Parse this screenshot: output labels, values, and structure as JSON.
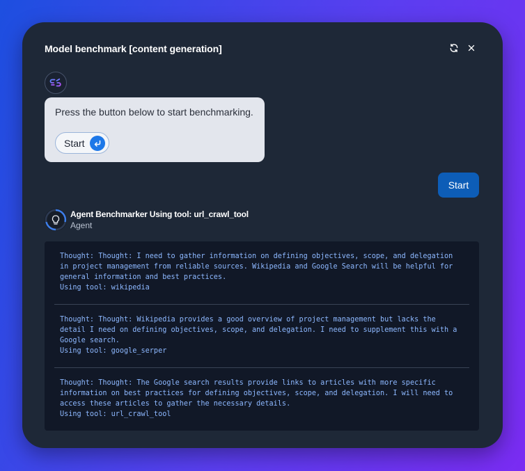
{
  "dialog": {
    "title": "Model benchmark [content generation]"
  },
  "header_icons": [
    "refresh-icon",
    "close-icon"
  ],
  "bot_message": {
    "text": "Press the button below to start benchmarking.",
    "start_button_label": "Start"
  },
  "user_message": {
    "text": "Start"
  },
  "agent": {
    "name": "Agent Benchmarker Using tool: url_crawl_tool",
    "role": "Agent"
  },
  "log_entries": [
    "Thought: Thought: I need to gather information on defining objectives, scope, and delegation\nin project management from reliable sources. Wikipedia and Google Search will be helpful for\ngeneral information and best practices.\nUsing tool: wikipedia",
    "Thought: Thought: Wikipedia provides a good overview of project management but lacks the\ndetail I need on defining objectives, scope, and delegation. I need to supplement this with a\nGoogle search.\nUsing tool: google_serper",
    "Thought: Thought: The Google search results provide links to articles with more specific\ninformation on best practices for defining objectives, scope, and delegation. I will need to\naccess these articles to gather the necessary details.\nUsing tool: url_crawl_tool"
  ],
  "colors": {
    "panel_bg": "#1e2837",
    "bubble_bg": "#e3e6ed",
    "accent_blue": "#0d5db7",
    "log_bg": "#111827",
    "log_text": "#8db8ff"
  }
}
